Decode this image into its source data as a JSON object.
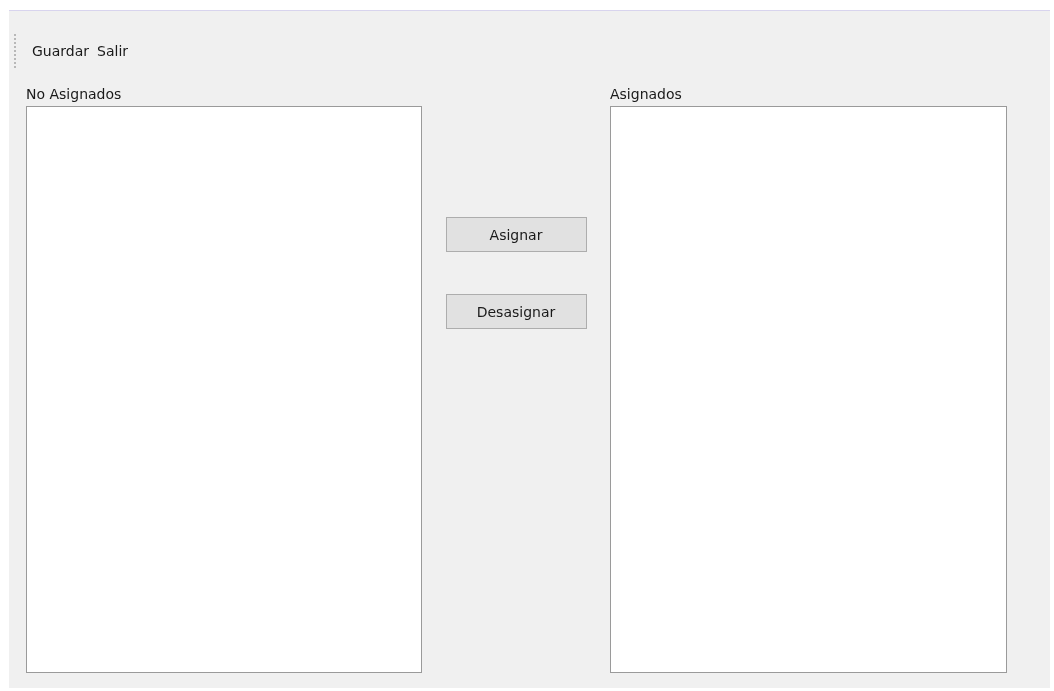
{
  "toolbar": {
    "items": [
      {
        "label": "Guardar"
      },
      {
        "label": "Salir"
      }
    ]
  },
  "unassigned": {
    "label": "No Asignados"
  },
  "assigned": {
    "label": "Asignados"
  },
  "buttons": [
    {
      "label": "Asignar"
    },
    {
      "label": "Desasignar"
    }
  ]
}
